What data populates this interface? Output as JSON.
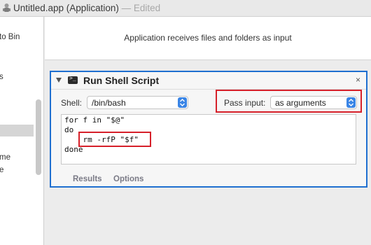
{
  "window": {
    "title": "Untitled.app (Application)",
    "separator": "—",
    "status": "Edited",
    "icon": "automator-robot-icon"
  },
  "sidebar": {
    "items": [
      {
        "label": "to Bin"
      },
      {
        "label": "s"
      },
      {
        "label": "me"
      },
      {
        "label": "e"
      }
    ]
  },
  "workflow": {
    "header_text": "Application receives files and folders as input"
  },
  "action": {
    "title": "Run Shell Script",
    "shell_label": "Shell:",
    "shell_value": "/bin/bash",
    "pass_input_label": "Pass input:",
    "pass_input_value": "as arguments",
    "close_glyph": "×",
    "script_lines": [
      "for f in \"$@\"",
      "do",
      "    rm -rfP \"$f\"",
      "done"
    ],
    "tabs": [
      {
        "label": "Results"
      },
      {
        "label": "Options"
      }
    ]
  },
  "colors": {
    "selection_border": "#1f6fd0",
    "highlight_box": "#d6202a",
    "popup_accent": "#3a85e6"
  }
}
